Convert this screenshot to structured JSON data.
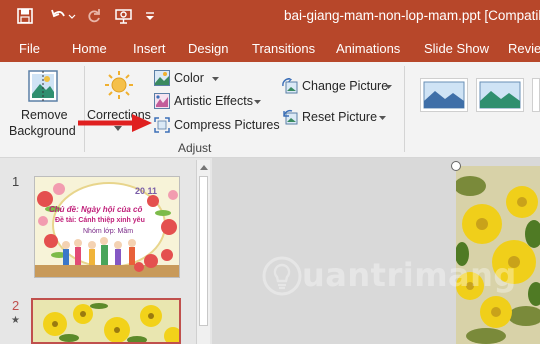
{
  "window": {
    "title": "bai-giang-mam-non-lop-mam.ppt [Compatibili",
    "quick_access": [
      "save-icon",
      "undo-icon",
      "redo-icon",
      "present-from-start-icon",
      "customize-qat-icon"
    ]
  },
  "tabs": [
    {
      "label": "File"
    },
    {
      "label": "Home"
    },
    {
      "label": "Insert"
    },
    {
      "label": "Design"
    },
    {
      "label": "Transitions"
    },
    {
      "label": "Animations"
    },
    {
      "label": "Slide Show"
    },
    {
      "label": "Review"
    }
  ],
  "ribbon": {
    "remove_background": {
      "line1": "Remove",
      "line2": "Background"
    },
    "corrections": {
      "label": "Corrections",
      "icon": "sun-icon"
    },
    "color": {
      "label": "Color"
    },
    "artistic_effects": {
      "label": "Artistic Effects"
    },
    "compress_pictures": {
      "label": "Compress Pictures"
    },
    "change_picture": {
      "label": "Change Picture"
    },
    "reset_picture": {
      "label": "Reset Picture"
    },
    "group_label": "Adjust"
  },
  "slides": [
    {
      "number": "1",
      "lines": [
        "Chủ đề: Ngày hội của cô",
        "Đề tài: Cánh thiệp xinh yêu",
        "Nhóm lớp: Mầm"
      ],
      "badge": "20 11"
    },
    {
      "number": "2",
      "note": "★"
    }
  ],
  "watermark": {
    "text": "uantrimang"
  },
  "colors": {
    "accent": "#b7472a",
    "arrow": "#e02020",
    "ribbon_bg": "#f3f3f3",
    "panel_bg": "#e6e6e6"
  }
}
